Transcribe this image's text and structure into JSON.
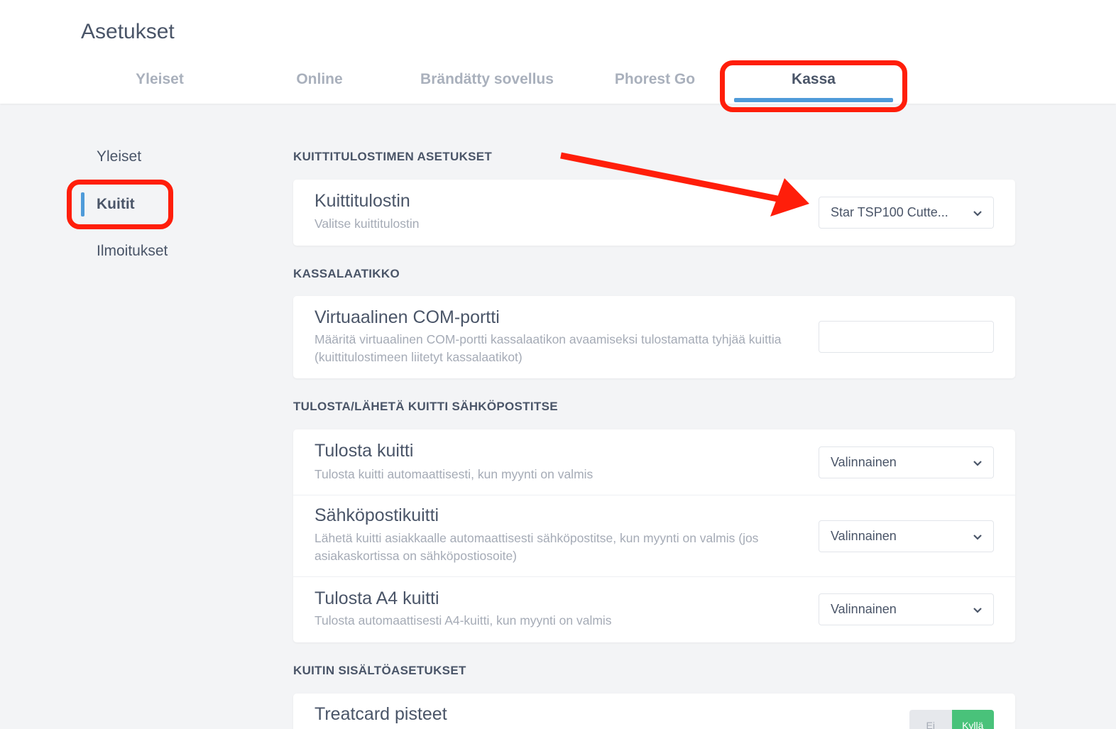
{
  "header": {
    "title": "Asetukset",
    "tabs": [
      {
        "label": "Yleiset"
      },
      {
        "label": "Online"
      },
      {
        "label": "Brändätty sovellus"
      },
      {
        "label": "Phorest Go"
      },
      {
        "label": "Kassa"
      }
    ],
    "active_tab": "Kassa"
  },
  "sidebar": {
    "items": [
      {
        "label": "Yleiset"
      },
      {
        "label": "Kuitit"
      },
      {
        "label": "Ilmoitukset"
      }
    ],
    "active_item": "Kuitit"
  },
  "sections": {
    "printer": {
      "heading": "KUITTITULOSTIMEN ASETUKSET",
      "title": "Kuittitulostin",
      "desc": "Valitse kuittitulostin",
      "value": "Star TSP100 Cutte..."
    },
    "drawer": {
      "heading": "KASSALAATIKKO",
      "title": "Virtuaalinen COM-portti",
      "desc": "Määritä virtuaalinen COM-portti kassalaatikon avaamiseksi tulostamatta tyhjää kuittia (kuittitulostimeen liitetyt kassalaatikot)",
      "value": ""
    },
    "email": {
      "heading": "TULOSTA/LÄHETÄ KUITTI SÄHKÖPOSTITSE",
      "rows": [
        {
          "title": "Tulosta kuitti",
          "desc": "Tulosta kuitti automaattisesti, kun myynti on valmis",
          "value": "Valinnainen"
        },
        {
          "title": "Sähköpostikuitti",
          "desc": "Lähetä kuitti asiakkaalle automaattisesti sähköpostitse, kun myynti on valmis (jos asiakaskortissa on sähköpostiosoite)",
          "value": "Valinnainen"
        },
        {
          "title": "Tulosta A4 kuitti",
          "desc": "Tulosta automaattisesti A4-kuitti, kun myynti on valmis",
          "value": "Valinnainen"
        }
      ]
    },
    "content": {
      "heading": "KUITIN SISÄLTÖASETUKSET",
      "title": "Treatcard pisteet",
      "toggle_off": "Ei",
      "toggle_on": "Kyllä"
    }
  },
  "colors": {
    "accent": "#4f9bd9",
    "annotation": "#ff1e0a",
    "toggle_on": "#49c27a"
  }
}
